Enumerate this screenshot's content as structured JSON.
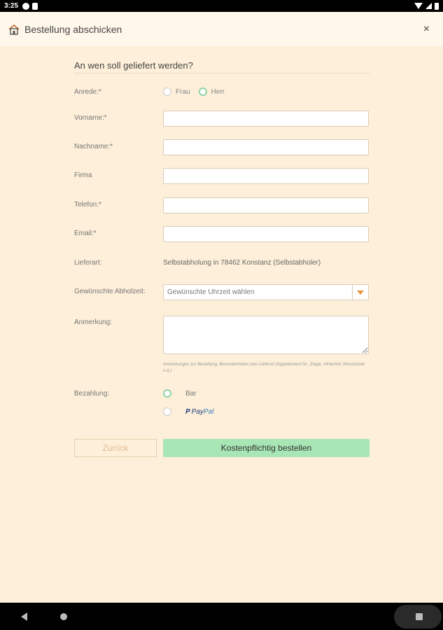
{
  "status_bar": {
    "time": "3:25"
  },
  "header": {
    "title": "Bestellung abschicken",
    "home_icon": "home-icon",
    "close_label": "×"
  },
  "form": {
    "section_title": "An wen soll geliefert werden?",
    "salutation": {
      "label": "Anrede:*",
      "options": [
        "Frau",
        "Herr"
      ],
      "selected": "Herr"
    },
    "first_name": {
      "label": "Vorname:*",
      "value": ""
    },
    "last_name": {
      "label": "Nachname:*",
      "value": ""
    },
    "company": {
      "label": "Firma",
      "value": ""
    },
    "phone": {
      "label": "Telefon:*",
      "value": ""
    },
    "email": {
      "label": "Email:*",
      "value": ""
    },
    "delivery": {
      "label": "Lieferart:",
      "value": "Selbstabholung in 78462 Konstanz (Selbstabholer)"
    },
    "pickup_time": {
      "label": "Gewünschte Abholzeit:",
      "selected": "Gewünschte Uhrzeit wählen"
    },
    "remark": {
      "label": "Anmerkung:",
      "value": "",
      "hint": "Anmerkungen zur Bestellung, Besonderheiten zum Lieferort (Appartement-Nr., Etage, Hinterhof, Wunschzeit o.ä.)"
    },
    "payment": {
      "label": "Bezahlung:",
      "options": [
        "Bar",
        "PayPal"
      ],
      "selected": "Bar",
      "paypal_p": "P",
      "paypal_pay": "Pay",
      "paypal_pal": "Pal"
    }
  },
  "buttons": {
    "back": "Zurück",
    "order": "Kostenpflichtig bestellen"
  },
  "colors": {
    "background": "#fdefd9",
    "header_bg": "#fff7ea",
    "accent_green": "#a8e6b5",
    "radio_checked": "#8ed3a4",
    "select_arrow": "#e8903a"
  }
}
